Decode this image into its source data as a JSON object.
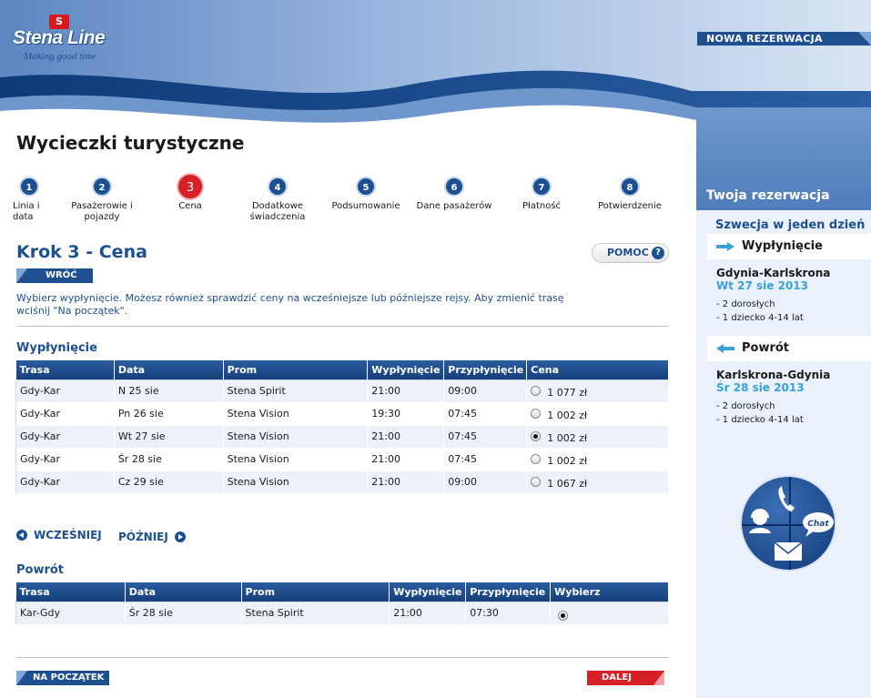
{
  "header": {
    "brand": "Stena Line",
    "flag": "S",
    "tagline": "Making good time",
    "new_reservation": "NOWA REZERWACJA"
  },
  "page_title": "Wycieczki turystyczne",
  "steps": [
    {
      "num": "1",
      "label_lines": [
        "Linia i",
        "data"
      ]
    },
    {
      "num": "2",
      "label_lines": [
        "Pasażerowie i",
        "pojazdy"
      ]
    },
    {
      "num": "3",
      "label_lines": [
        "Cena"
      ]
    },
    {
      "num": "4",
      "label_lines": [
        "Dodatkowe",
        "świadczenia"
      ]
    },
    {
      "num": "5",
      "label_lines": [
        "Podsumowanie"
      ]
    },
    {
      "num": "6",
      "label_lines": [
        "Dane pasażerów"
      ]
    },
    {
      "num": "7",
      "label_lines": [
        "Płatność"
      ]
    },
    {
      "num": "8",
      "label_lines": [
        "Potwierdzenie"
      ]
    }
  ],
  "step_heading": "Krok 3 - Cena",
  "help": {
    "label": "POMOC",
    "icon": "?"
  },
  "back_label": "WRÓĆ",
  "intro": "Wybierz wypłynięcie. Możesz również sprawdzić ceny na wcześniejsze lub późniejsze rejsy. Aby zmienić trasę wciśnij \"Na początek\".",
  "outbound": {
    "title": "Wypłynięcie",
    "headers": [
      "Trasa",
      "Data",
      "Prom",
      "Wypłynięcie",
      "Przypłynięcie",
      "Cena"
    ],
    "rows": [
      {
        "route": "Gdy-Kar",
        "date": "N 25 sie",
        "ship": "Stena Spirit",
        "dep": "21:00",
        "arr": "09:00",
        "price": "1 077 zł",
        "selected": false
      },
      {
        "route": "Gdy-Kar",
        "date": "Pn 26 sie",
        "ship": "Stena Vision",
        "dep": "19:30",
        "arr": "07:45",
        "price": "1 002 zł",
        "selected": false
      },
      {
        "route": "Gdy-Kar",
        "date": "Wt 27 sie",
        "ship": "Stena Vision",
        "dep": "21:00",
        "arr": "07:45",
        "price": "1 002 zł",
        "selected": true
      },
      {
        "route": "Gdy-Kar",
        "date": "Śr 28 sie",
        "ship": "Stena Vision",
        "dep": "21:00",
        "arr": "07:45",
        "price": "1 002 zł",
        "selected": false
      },
      {
        "route": "Gdy-Kar",
        "date": "Cz 29 sie",
        "ship": "Stena Vision",
        "dep": "21:00",
        "arr": "09:00",
        "price": "1 067 zł",
        "selected": false
      }
    ]
  },
  "nav": {
    "earlier": "WCZEŚNIEJ",
    "later": "PÓŹNIEJ"
  },
  "return": {
    "title": "Powrót",
    "headers": [
      "Trasa",
      "Data",
      "Prom",
      "Wypłynięcie",
      "Przypłynięcie",
      "Wybierz"
    ],
    "rows": [
      {
        "route": "Kar-Gdy",
        "date": "Śr 28 sie",
        "ship": "Stena Spirit",
        "dep": "21:00",
        "arr": "07:30",
        "selected": true
      }
    ]
  },
  "buttons": {
    "start": "NA POCZĄTEK",
    "next": "DALEJ"
  },
  "sidebar": {
    "title": "Twoja rezerwacja",
    "trip_name": "Szwecja w jeden dzień",
    "outbound": {
      "label": "Wypłynięcie",
      "route": "Gdynia-Karlskrona",
      "date": "Wt 27 sie 2013",
      "pax": [
        "- 2 dorosłych",
        "- 1 dziecko 4-14 lat"
      ]
    },
    "return": {
      "label": "Powrót",
      "route": "Karlskrona-Gdynia",
      "date": "Śr 28 sie 2013",
      "pax": [
        "- 2 dorosłych",
        "- 1 dziecko 4-14 lat"
      ]
    },
    "chat_label": "Chat"
  },
  "colors": {
    "brand_blue": "#1d4f91",
    "accent_red": "#d62027",
    "light_blue": "#3aa0d8"
  }
}
